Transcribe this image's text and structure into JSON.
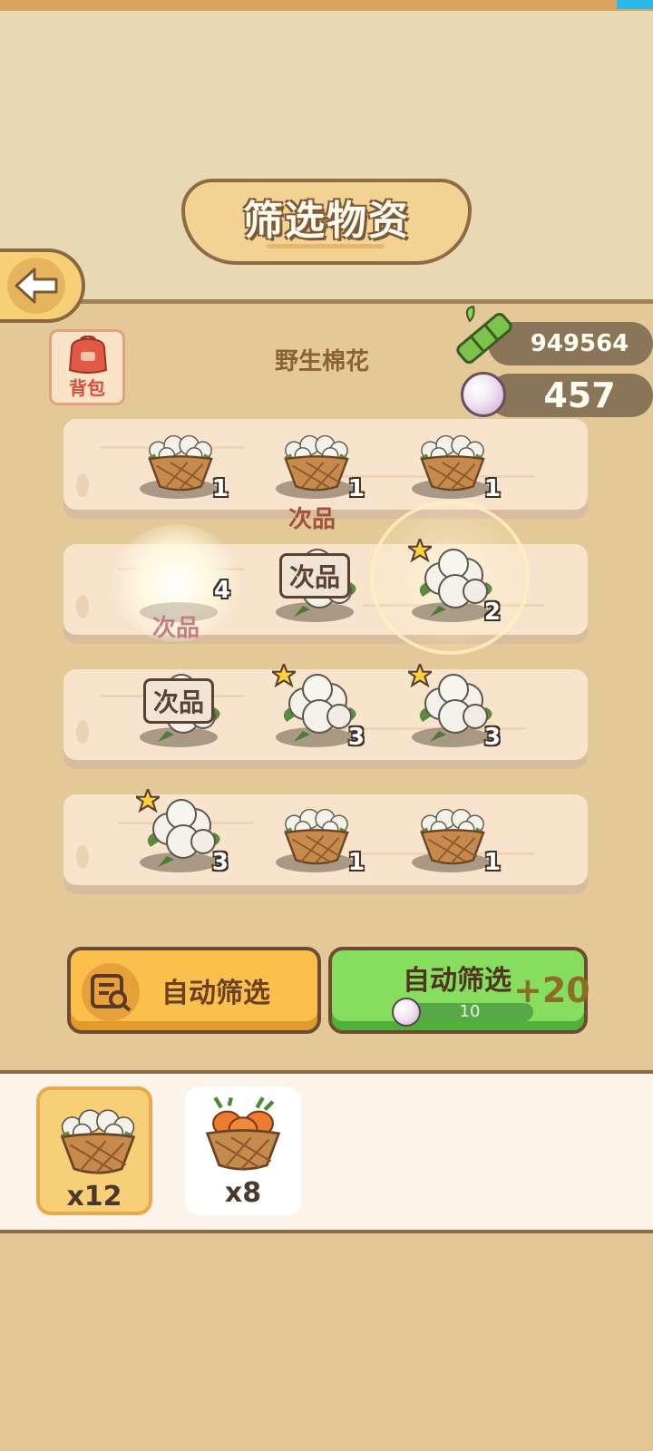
{
  "header": {
    "title": "筛选物资"
  },
  "back_button": {
    "icon": "arrow-left-icon"
  },
  "bag": {
    "label": "背包",
    "icon": "backpack-icon"
  },
  "material": {
    "name": "野生棉花"
  },
  "currencies": [
    {
      "icon": "bamboo-icon",
      "value": "949564"
    },
    {
      "icon": "pearl-icon",
      "value": "457"
    }
  ],
  "grid": {
    "rows": [
      {
        "slots": [
          {
            "kind": "basket",
            "count": "1",
            "star": false
          },
          {
            "kind": "basket",
            "count": "1",
            "star": false
          },
          {
            "kind": "basket",
            "count": "1",
            "star": false
          }
        ]
      },
      {
        "slots": [
          {
            "kind": "glow",
            "count": "4",
            "star": false,
            "tag": "次品"
          },
          {
            "kind": "cotton",
            "count": "",
            "star": false,
            "tag": "次品"
          },
          {
            "kind": "cotton",
            "count": "2",
            "star": true
          }
        ]
      },
      {
        "slots": [
          {
            "kind": "cotton",
            "count": "",
            "star": false,
            "tag": "次品"
          },
          {
            "kind": "cotton",
            "count": "3",
            "star": true
          },
          {
            "kind": "cotton",
            "count": "3",
            "star": true
          }
        ]
      },
      {
        "slots": [
          {
            "kind": "cotton",
            "count": "3",
            "star": true
          },
          {
            "kind": "basket",
            "count": "1",
            "star": false
          },
          {
            "kind": "basket",
            "count": "1",
            "star": false
          }
        ]
      }
    ],
    "floating_labels": [
      "次品",
      "次品"
    ]
  },
  "buttons": {
    "auto_filter": {
      "label": "自动筛选",
      "icon": "search-list-icon"
    },
    "auto_filter_paid": {
      "label": "自动筛选",
      "cost": "10",
      "bonus": "+20",
      "cost_icon": "pearl-icon"
    }
  },
  "inventory": [
    {
      "name": "cotton-basket",
      "count": "x12",
      "selected": true
    },
    {
      "name": "carrot-basket",
      "count": "x8",
      "selected": false
    }
  ],
  "colors": {
    "panel": "#e4c998",
    "shelf": "#f8e4cd",
    "accent_yellow": "#fbc04c",
    "accent_green": "#86dd5e"
  }
}
